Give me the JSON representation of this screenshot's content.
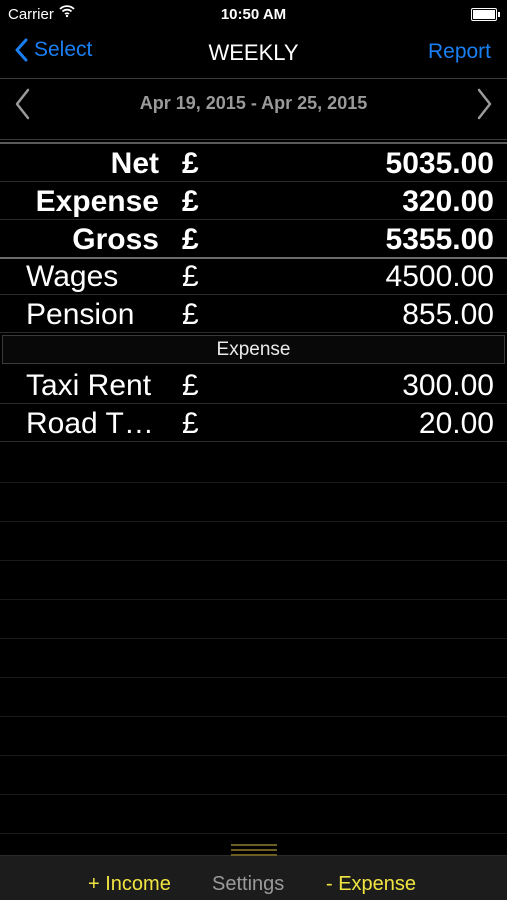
{
  "status": {
    "carrier": "Carrier",
    "time": "10:50 AM"
  },
  "nav": {
    "back_label": "Select",
    "title": "WEEKLY",
    "report_label": "Report"
  },
  "date_range": "Apr 19, 2015 - Apr 25, 2015",
  "currency": "£",
  "summary": [
    {
      "label": "Net",
      "value": "5035.00"
    },
    {
      "label": "Expense",
      "value": "320.00"
    },
    {
      "label": "Gross",
      "value": "5355.00"
    }
  ],
  "income_items": [
    {
      "label": "Wages",
      "value": "4500.00"
    },
    {
      "label": "Pension",
      "value": "855.00"
    }
  ],
  "expense_header": "Expense",
  "expense_items": [
    {
      "label": "Taxi Rent",
      "value": "300.00"
    },
    {
      "label": "Road T…",
      "value": "20.00"
    }
  ],
  "toolbar": {
    "income_label": "+ Income",
    "settings_label": "Settings",
    "expense_label": "- Expense"
  },
  "colors": {
    "accent_blue": "#1a7ff2",
    "accent_yellow": "#f0e442",
    "muted": "#9a9a9a"
  }
}
